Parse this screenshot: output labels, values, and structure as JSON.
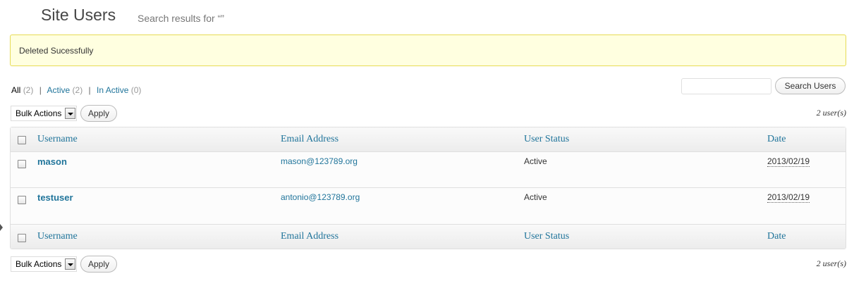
{
  "header": {
    "title": "Site Users",
    "subtitle": "Search results for “”"
  },
  "notice": {
    "text": "Deleted Sucessfully"
  },
  "filters": [
    {
      "label": "All",
      "count": "(2)"
    },
    {
      "label": "Active",
      "count": "(2)"
    },
    {
      "label": "In Active",
      "count": "(0)"
    }
  ],
  "search": {
    "value": "",
    "button_label": "Search Users"
  },
  "bulk_top": {
    "selected": "Bulk Actions",
    "apply_label": "Apply"
  },
  "bulk_bottom": {
    "selected": "Bulk Actions",
    "apply_label": "Apply"
  },
  "user_count": "2 user(s)",
  "table": {
    "columns": [
      "Username",
      "Email Address",
      "User Status",
      "Date"
    ],
    "rows": [
      {
        "username": "mason",
        "email": "mason@123789.org",
        "status": "Active",
        "date": "2013/02/19"
      },
      {
        "username": "testuser",
        "email": "antonio@123789.org",
        "status": "Active",
        "date": "2013/02/19"
      }
    ]
  },
  "colors": {
    "link": "#21759b",
    "notice_bg": "#ffffe0",
    "notice_border": "#e6db55"
  }
}
